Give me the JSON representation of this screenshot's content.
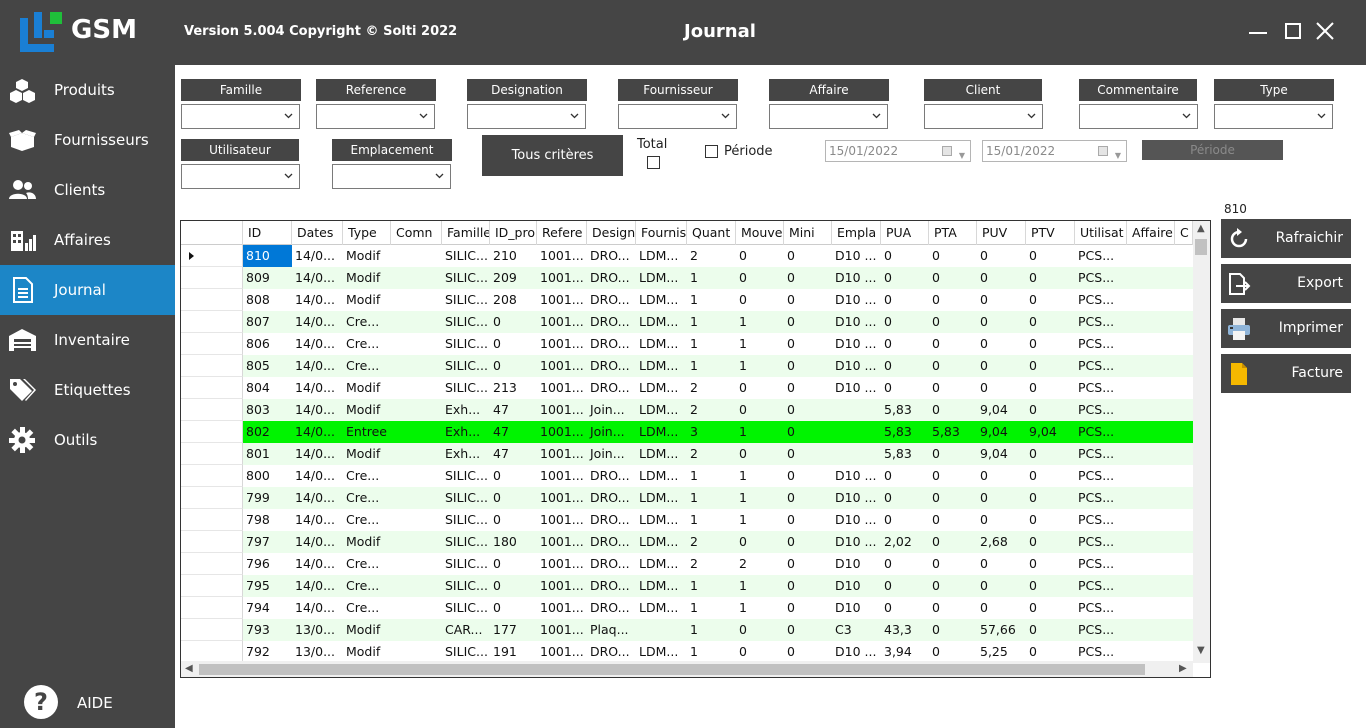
{
  "app": {
    "logo_text": "GSM",
    "version": "Version 5.004  Copyright © Solti 2022",
    "window_title": "Journal"
  },
  "sidebar": {
    "items": [
      {
        "label": "Produits",
        "icon": "boxes-icon"
      },
      {
        "label": "Fournisseurs",
        "icon": "open-box-icon"
      },
      {
        "label": "Clients",
        "icon": "users-icon"
      },
      {
        "label": "Affaires",
        "icon": "building-chart-icon"
      },
      {
        "label": "Journal",
        "icon": "document-icon"
      },
      {
        "label": "Inventaire",
        "icon": "warehouse-icon"
      },
      {
        "label": "Etiquettes",
        "icon": "tags-icon"
      },
      {
        "label": "Outils",
        "icon": "gear-icon"
      }
    ],
    "active": "Journal",
    "help_label": "AIDE",
    "help_icon": "help-icon"
  },
  "filters": {
    "famille": "Famille",
    "reference": "Reference",
    "designation": "Designation",
    "fournisseur": "Fournisseur",
    "affaire": "Affaire",
    "client": "Client",
    "commentaire": "Commentaire",
    "type": "Type",
    "utilisateur": "Utilisateur",
    "emplacement": "Emplacement",
    "tous_criteres": "Tous critères",
    "total": "Total",
    "periode": "Période",
    "date_from": "15/01/2022",
    "date_to": "15/01/2022",
    "periode_button": "Période"
  },
  "count": "810",
  "grid": {
    "columns": [
      "ID",
      "Dates",
      "Type",
      "Comn",
      "Famille",
      "ID_pro",
      "Refere",
      "Design",
      "Fournis",
      "Quant",
      "Mouve",
      "Mini",
      "Empla",
      "PUA",
      "PTA",
      "PUV",
      "PTV",
      "Utilisat",
      "Affaire",
      "C"
    ],
    "rows": [
      [
        "810",
        "14/0...",
        "Modif",
        "",
        "SILIC...",
        "210",
        "1001...",
        "DRO...",
        "LDM...",
        "2",
        "0",
        "0",
        "D10 ...",
        "0",
        "0",
        "0",
        "0",
        "PCS...",
        ""
      ],
      [
        "809",
        "14/0...",
        "Modif",
        "",
        "SILIC...",
        "209",
        "1001...",
        "DRO...",
        "LDM...",
        "1",
        "0",
        "0",
        "D10 ...",
        "0",
        "0",
        "0",
        "0",
        "PCS...",
        ""
      ],
      [
        "808",
        "14/0...",
        "Modif",
        "",
        "SILIC...",
        "208",
        "1001...",
        "DRO...",
        "LDM...",
        "1",
        "0",
        "0",
        "D10 ...",
        "0",
        "0",
        "0",
        "0",
        "PCS...",
        ""
      ],
      [
        "807",
        "14/0...",
        "Cre...",
        "",
        "SILIC...",
        "0",
        "1001...",
        "DRO...",
        "LDM...",
        "1",
        "1",
        "0",
        "D10 ...",
        "0",
        "0",
        "0",
        "0",
        "PCS...",
        ""
      ],
      [
        "806",
        "14/0...",
        "Cre...",
        "",
        "SILIC...",
        "0",
        "1001...",
        "DRO...",
        "LDM...",
        "1",
        "1",
        "0",
        "D10 ...",
        "0",
        "0",
        "0",
        "0",
        "PCS...",
        ""
      ],
      [
        "805",
        "14/0...",
        "Cre...",
        "",
        "SILIC...",
        "0",
        "1001...",
        "DRO...",
        "LDM...",
        "1",
        "1",
        "0",
        "D10 ...",
        "0",
        "0",
        "0",
        "0",
        "PCS...",
        ""
      ],
      [
        "804",
        "14/0...",
        "Modif",
        "",
        "SILIC...",
        "213",
        "1001...",
        "DRO...",
        "LDM...",
        "2",
        "0",
        "0",
        "D10 ...",
        "0",
        "0",
        "0",
        "0",
        "PCS...",
        ""
      ],
      [
        "803",
        "14/0...",
        "Modif",
        "",
        "Exh...",
        "47",
        "1001...",
        "Join...",
        "LDM...",
        "2",
        "0",
        "0",
        "",
        "5,83",
        "0",
        "9,04",
        "0",
        "PCS...",
        ""
      ],
      [
        "802",
        "14/0...",
        "Entree",
        "",
        "Exh...",
        "47",
        "1001...",
        "Join...",
        "LDM...",
        "3",
        "1",
        "0",
        "",
        "5,83",
        "5,83",
        "9,04",
        "9,04",
        "PCS...",
        ""
      ],
      [
        "801",
        "14/0...",
        "Modif",
        "",
        "Exh...",
        "47",
        "1001...",
        "Join...",
        "LDM...",
        "2",
        "0",
        "0",
        "",
        "5,83",
        "0",
        "9,04",
        "0",
        "PCS...",
        ""
      ],
      [
        "800",
        "14/0...",
        "Cre...",
        "",
        "SILIC...",
        "0",
        "1001...",
        "DRO...",
        "LDM...",
        "1",
        "1",
        "0",
        "D10 ...",
        "0",
        "0",
        "0",
        "0",
        "PCS...",
        ""
      ],
      [
        "799",
        "14/0...",
        "Cre...",
        "",
        "SILIC...",
        "0",
        "1001...",
        "DRO...",
        "LDM...",
        "1",
        "1",
        "0",
        "D10 ...",
        "0",
        "0",
        "0",
        "0",
        "PCS...",
        ""
      ],
      [
        "798",
        "14/0...",
        "Cre...",
        "",
        "SILIC...",
        "0",
        "1001...",
        "DRO...",
        "LDM...",
        "1",
        "1",
        "0",
        "D10 ...",
        "0",
        "0",
        "0",
        "0",
        "PCS...",
        ""
      ],
      [
        "797",
        "14/0...",
        "Modif",
        "",
        "SILIC...",
        "180",
        "1001...",
        "DRO...",
        "LDM...",
        "2",
        "0",
        "0",
        "D10 ...",
        "2,02",
        "0",
        "2,68",
        "0",
        "PCS...",
        ""
      ],
      [
        "796",
        "14/0...",
        "Cre...",
        "",
        "SILIC...",
        "0",
        "1001...",
        "DRO...",
        "LDM...",
        "2",
        "2",
        "0",
        "D10",
        "0",
        "0",
        "0",
        "0",
        "PCS...",
        ""
      ],
      [
        "795",
        "14/0...",
        "Cre...",
        "",
        "SILIC...",
        "0",
        "1001...",
        "DRO...",
        "LDM...",
        "1",
        "1",
        "0",
        "D10",
        "0",
        "0",
        "0",
        "0",
        "PCS...",
        ""
      ],
      [
        "794",
        "14/0...",
        "Cre...",
        "",
        "SILIC...",
        "0",
        "1001...",
        "DRO...",
        "LDM...",
        "1",
        "1",
        "0",
        "D10",
        "0",
        "0",
        "0",
        "0",
        "PCS...",
        ""
      ],
      [
        "793",
        "13/0...",
        "Modif",
        "",
        "CAR...",
        "177",
        "1001...",
        "Plaq...",
        "",
        "1",
        "0",
        "0",
        "C3",
        "43,3",
        "0",
        "57,66",
        "0",
        "PCS...",
        ""
      ],
      [
        "792",
        "13/0...",
        "Modif",
        "",
        "SILIC...",
        "191",
        "1001...",
        "DRO...",
        "LDM...",
        "1",
        "0",
        "0",
        "D10 ...",
        "3,94",
        "0",
        "5,25",
        "0",
        "PCS...",
        ""
      ]
    ],
    "selected_row": 0,
    "highlight_row": 8,
    "highlight_color": "#00f400",
    "alt_row_color": "#ecfdec"
  },
  "actions": {
    "rafraichir": "Rafraichir",
    "export": "Export",
    "imprimer": "Imprimer",
    "facture": "Facture"
  },
  "colors": {
    "chrome": "#454545",
    "active": "#1c86c7",
    "selection": "#0078d7"
  }
}
